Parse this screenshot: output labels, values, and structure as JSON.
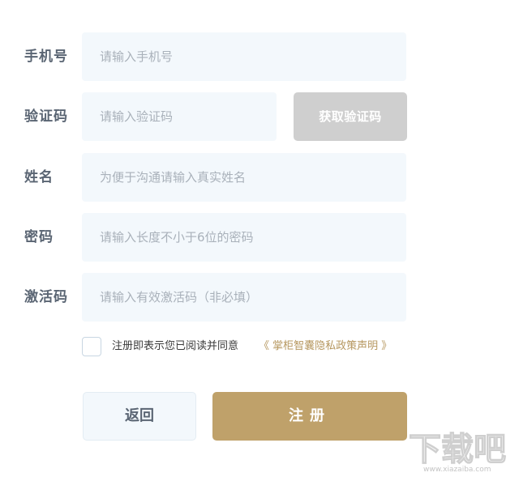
{
  "form": {
    "phone": {
      "label": "手机号",
      "placeholder": "请输入手机号"
    },
    "code": {
      "label": "验证码",
      "placeholder": "请输入验证码",
      "button_label": "获取验证码"
    },
    "name": {
      "label": "姓名",
      "placeholder": "为便于沟通请输入真实姓名"
    },
    "password": {
      "label": "密码",
      "placeholder": "请输入长度不小于6位的密码"
    },
    "activation": {
      "label": "激活码",
      "placeholder": "请输入有效激活码（非必填）"
    }
  },
  "agreement": {
    "checked": false,
    "text": "注册即表示您已阅读并同意",
    "link_text": "《 掌柜智囊隐私政策声明 》"
  },
  "actions": {
    "back_label": "返回",
    "register_label": "注册"
  },
  "watermark": {
    "logo_text": "下载吧",
    "url_text": "www.xiazaiba.com"
  },
  "colors": {
    "field_bg": "#f3f8fc",
    "label_text": "#5a6573",
    "accent_gold": "#bfa16a",
    "disabled_button": "#cfcfcf",
    "link_gold": "#b6975f"
  }
}
